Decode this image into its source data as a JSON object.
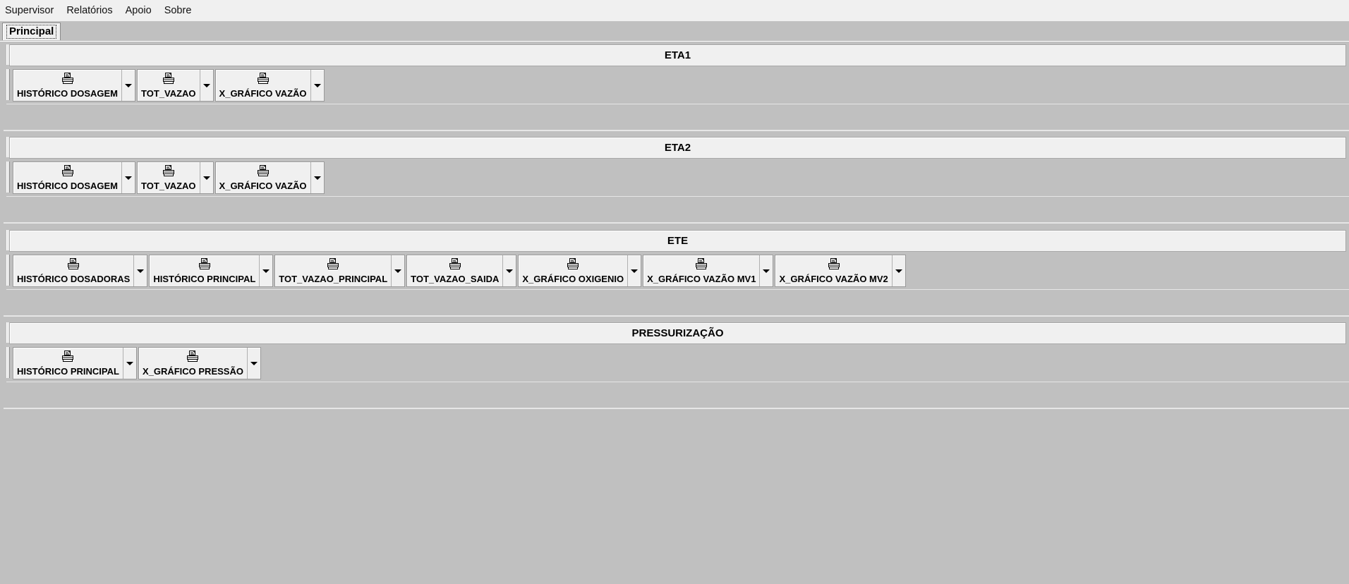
{
  "menu": [
    "Supervisor",
    "Relatórios",
    "Apoio",
    "Sobre"
  ],
  "tabs": [
    {
      "label": "Principal"
    }
  ],
  "groups": [
    {
      "title": "ETA1",
      "buttons": [
        "HISTÓRICO DOSAGEM",
        "TOT_VAZAO",
        "X_GRÁFICO VAZÃO"
      ]
    },
    {
      "title": "ETA2",
      "buttons": [
        "HISTÓRICO DOSAGEM",
        "TOT_VAZAO",
        "X_GRÁFICO VAZÃO"
      ]
    },
    {
      "title": "ETE",
      "buttons": [
        "HISTÓRICO DOSADORAS",
        "HISTÓRICO PRINCIPAL",
        "TOT_VAZAO_PRINCIPAL",
        "TOT_VAZAO_SAIDA",
        "X_GRÁFICO OXIGENIO",
        "X_GRÁFICO VAZÃO MV1",
        "X_GRÁFICO VAZÃO MV2"
      ]
    },
    {
      "title": "PRESSURIZAÇÃO",
      "buttons": [
        "HISTÓRICO PRINCIPAL",
        "X_GRÁFICO PRESSÃO"
      ]
    }
  ],
  "button_icon": "printer-icon"
}
